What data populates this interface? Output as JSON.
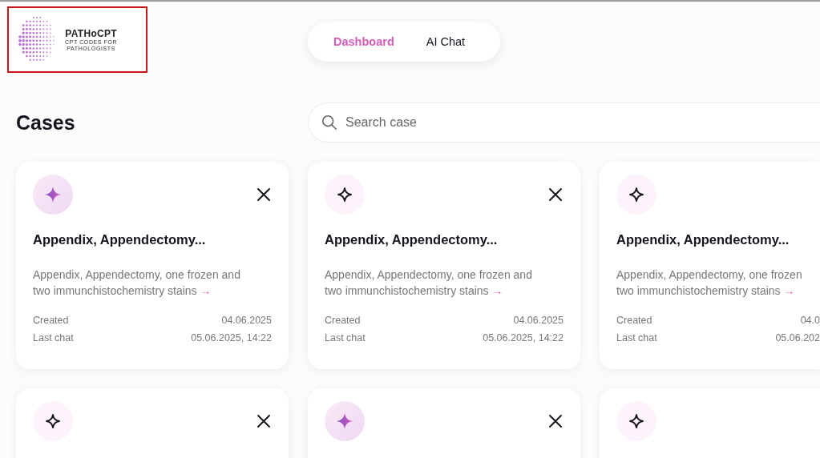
{
  "logo": {
    "name": "PATHoCPT",
    "tagline_lines": [
      "CPT CODES FOR",
      "PATHOLOGISTS"
    ]
  },
  "nav": [
    {
      "label": "Dashboard",
      "selected": true
    },
    {
      "label": "AI Chat",
      "selected": false
    }
  ],
  "heading": "Cases",
  "search": {
    "placeholder": "Search case"
  },
  "cards": [
    {
      "active": true,
      "show_close": true,
      "title": "Appendix, Appendectomy...",
      "description_lines": [
        "Appendix, Appendectomy, one frozen and",
        "two immunchistochemistry stains"
      ],
      "link_arrow": "→",
      "meta": [
        {
          "label": "Created",
          "value": "04.06.2025"
        },
        {
          "label": "Last chat",
          "value": "05.06.2025, 14:22"
        }
      ]
    },
    {
      "active": false,
      "show_close": true,
      "title": "Appendix, Appendectomy...",
      "description_lines": [
        "Appendix, Appendectomy, one frozen and",
        "two immunchistochemistry stains"
      ],
      "link_arrow": "→",
      "meta": [
        {
          "label": "Created",
          "value": "04.06.2025"
        },
        {
          "label": "Last chat",
          "value": "05.06.2025, 14:22"
        }
      ]
    },
    {
      "active": false,
      "show_close": false,
      "title": "Appendix, Appendectomy...",
      "description_lines": [
        "Appendix, Appendectomy, one frozen",
        "two immunchistochemistry stains"
      ],
      "link_arrow": "→",
      "meta": [
        {
          "label": "Created",
          "value": "04.0"
        },
        {
          "label": "Last chat",
          "value": "05.06.202"
        }
      ]
    },
    {
      "active": false,
      "show_close": true
    },
    {
      "active": true,
      "show_close": true
    },
    {
      "active": false,
      "show_close": false
    }
  ]
}
